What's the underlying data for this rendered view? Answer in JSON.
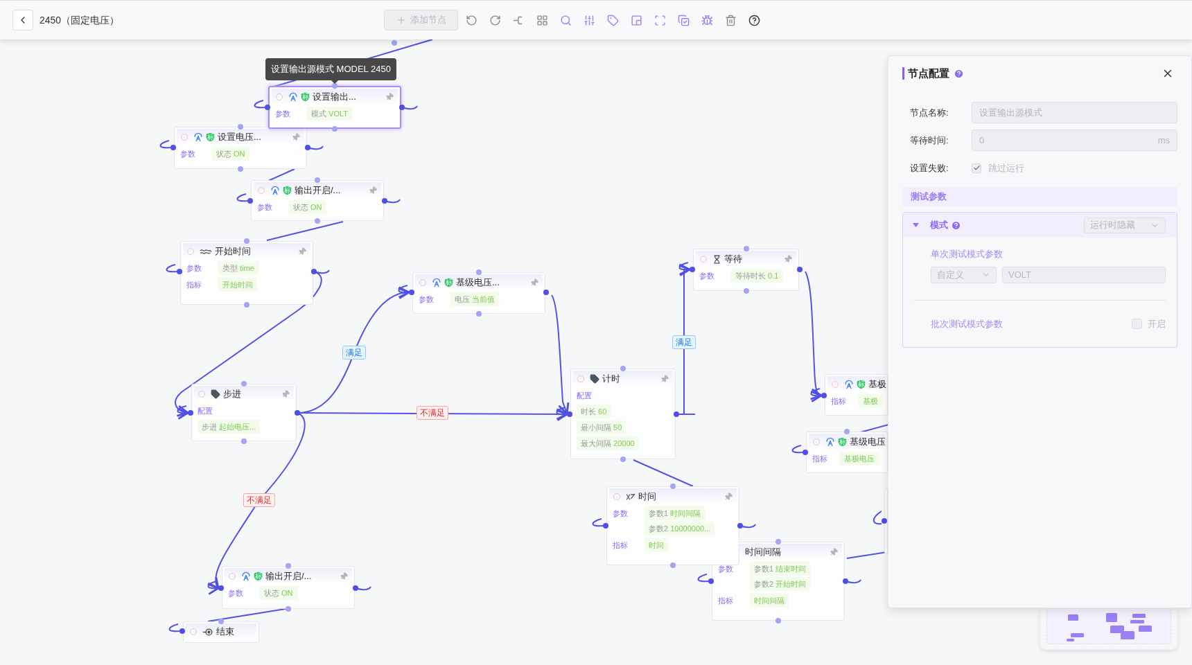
{
  "toolbar": {
    "title": "2450（固定电压）",
    "add_button": {
      "label": "添加节点",
      "disabled": true
    },
    "tools": [
      {
        "kind": "undo",
        "disabled": true
      },
      {
        "kind": "redo",
        "disabled": true
      },
      {
        "kind": "connect",
        "disabled": true
      },
      {
        "kind": "layout",
        "disabled": true
      },
      {
        "kind": "search",
        "disabled": false
      },
      {
        "kind": "adjust",
        "disabled": false
      },
      {
        "kind": "tag",
        "disabled": false
      },
      {
        "kind": "panel",
        "disabled": false
      },
      {
        "kind": "fullscreen",
        "disabled": false
      },
      {
        "kind": "checklist",
        "disabled": false
      },
      {
        "kind": "debug",
        "disabled": false
      },
      {
        "kind": "delete",
        "disabled": true
      },
      {
        "kind": "help"
      }
    ]
  },
  "tooltip": "设置输出源模式 MODEL 2450",
  "nodes": [
    {
      "kind": "instrument",
      "badge": "标",
      "title": "设置输出...",
      "selected": true,
      "rows": [
        {
          "label": "参数",
          "kind": "inline",
          "chips": [
            {
              "name": "模式",
              "value": "VOLT"
            }
          ]
        }
      ]
    },
    {
      "kind": "instrument",
      "badge": "标",
      "title": "设置电压...",
      "selected": false,
      "rows": [
        {
          "label": "参数",
          "kind": "inline",
          "chips": [
            {
              "name": "状态",
              "value": "ON"
            }
          ]
        }
      ]
    },
    {
      "kind": "instrument",
      "badge": "标",
      "title": "输出开启/...",
      "selected": false,
      "rows": [
        {
          "label": "参数",
          "kind": "inline",
          "chips": [
            {
              "name": "状态",
              "value": "ON"
            }
          ]
        }
      ]
    },
    {
      "kind": "start_time",
      "title": "开始时间",
      "selected": false,
      "rows": [
        {
          "label": "参数",
          "kind": "inline",
          "chips": [
            {
              "name": "类型",
              "value": "time"
            }
          ]
        },
        {
          "label": "指标",
          "kind": "inline",
          "chips": [
            {
              "value": "开始时间"
            }
          ]
        }
      ]
    },
    {
      "kind": "instrument",
      "badge": "标",
      "title": "基级电压...",
      "selected": false,
      "rows": [
        {
          "label": "参数",
          "kind": "inline",
          "chips": [
            {
              "name": "电压",
              "value": "当前值"
            }
          ]
        }
      ]
    },
    {
      "kind": "wait",
      "title": "等待",
      "selected": false,
      "rows": [
        {
          "label": "参数",
          "kind": "inline",
          "chips": [
            {
              "name": "等待时长",
              "value": "0.1"
            }
          ]
        }
      ]
    },
    {
      "kind": "step",
      "title": "步进",
      "selected": false,
      "rows": [
        {
          "label": "配置",
          "kind": "stacked",
          "chips": [
            {
              "name": "步进",
              "value": "起始电压..."
            }
          ]
        }
      ]
    },
    {
      "kind": "instrument",
      "badge": "标",
      "title": "基极",
      "selected": false,
      "rows": [
        {
          "label": "指标",
          "kind": "inline",
          "chips": [
            {
              "value": "基极"
            }
          ]
        }
      ]
    },
    {
      "kind": "timer",
      "title": "计时",
      "selected": false,
      "rows": [
        {
          "label": "配置",
          "kind": "stacked",
          "chips": [
            {
              "name": "时长",
              "value": "60"
            },
            {
              "name": "最小间隔",
              "value": "50"
            },
            {
              "name": "最大间隔",
              "value": "20000"
            }
          ]
        }
      ]
    },
    {
      "kind": "instrument",
      "badge": "标",
      "title": "基级电压",
      "selected": false,
      "rows": [
        {
          "label": "指标",
          "kind": "inline",
          "chips": [
            {
              "value": "基极电压"
            }
          ]
        }
      ]
    },
    {
      "kind": "function",
      "title": "时间",
      "selected": false,
      "rows": [
        {
          "label": "参数",
          "kind": "inline",
          "chips": [
            {
              "name": "参数1",
              "value": "时间间隔"
            },
            {
              "name": "参数2",
              "value": "10000000..."
            }
          ]
        },
        {
          "label": "指标",
          "kind": "inline",
          "chips": [
            {
              "value": "时间"
            }
          ]
        }
      ]
    },
    {
      "title": "时间间隔",
      "selected": false,
      "rows": [
        {
          "label": "参数",
          "kind": "inline",
          "chips": [
            {
              "name": "参数1",
              "value": "结束时间"
            },
            {
              "name": "参数2",
              "value": "开始时间"
            }
          ]
        },
        {
          "label": "指标",
          "kind": "inline",
          "chips": [
            {
              "value": "时间间隔"
            }
          ]
        }
      ]
    },
    {
      "kind": "instrument",
      "badge": "标",
      "title": "输出开启/...",
      "selected": false,
      "rows": [
        {
          "label": "参数",
          "kind": "inline",
          "chips": [
            {
              "name": "状态",
              "value": "ON"
            }
          ]
        }
      ]
    },
    {
      "kind": "end",
      "title": "结束",
      "selected": false
    }
  ],
  "edge_labels": [
    {
      "text": "满足",
      "kind": "met"
    },
    {
      "text": "不满足",
      "kind": "unmet"
    },
    {
      "text": "不满足",
      "kind": "unmet"
    },
    {
      "text": "满足",
      "kind": "met"
    }
  ],
  "config_panel": {
    "title": "节点配置",
    "fields": [
      {
        "kind": "text",
        "label": "节点名称:",
        "value": "设置输出源模式",
        "disabled": true
      },
      {
        "kind": "text",
        "label": "等待时间:",
        "value": "0",
        "suffix": "ms",
        "disabled": true
      },
      {
        "kind": "checkbox",
        "label": "设置失败:",
        "option": "跳过运行",
        "checked": true,
        "disabled": true
      }
    ],
    "section": "测试参数",
    "group": {
      "title": "模式",
      "expanded": true,
      "select": "运行时隐藏",
      "single": {
        "title": "单次测试模式参数",
        "select": "自定义",
        "value": "VOLT"
      },
      "batch": {
        "title": "批次测试模式参数",
        "option": "开启",
        "checked": false
      }
    }
  }
}
